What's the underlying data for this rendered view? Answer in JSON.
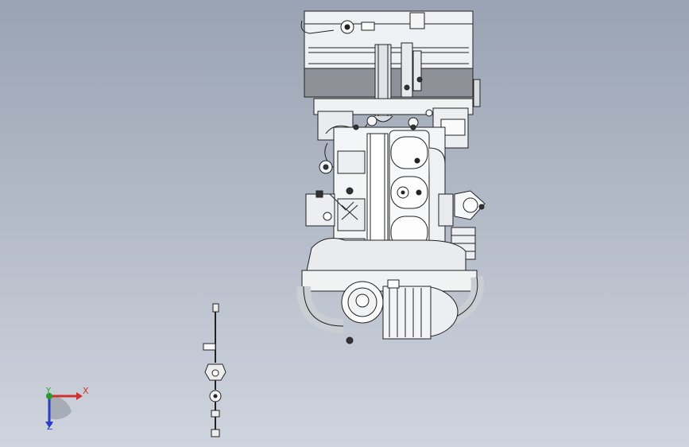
{
  "viewport": {
    "background_top": "#9aa3b3",
    "background_bottom": "#cfd4de"
  },
  "model": {
    "main_part": "engine-assembly",
    "secondary_part": "shaft-fitting"
  },
  "triad": {
    "x_label": "X",
    "y_label": "Y",
    "z_label": "Z",
    "x_color": "#d03030",
    "y_color": "#2a9a2a",
    "z_color": "#2c3fbf"
  }
}
